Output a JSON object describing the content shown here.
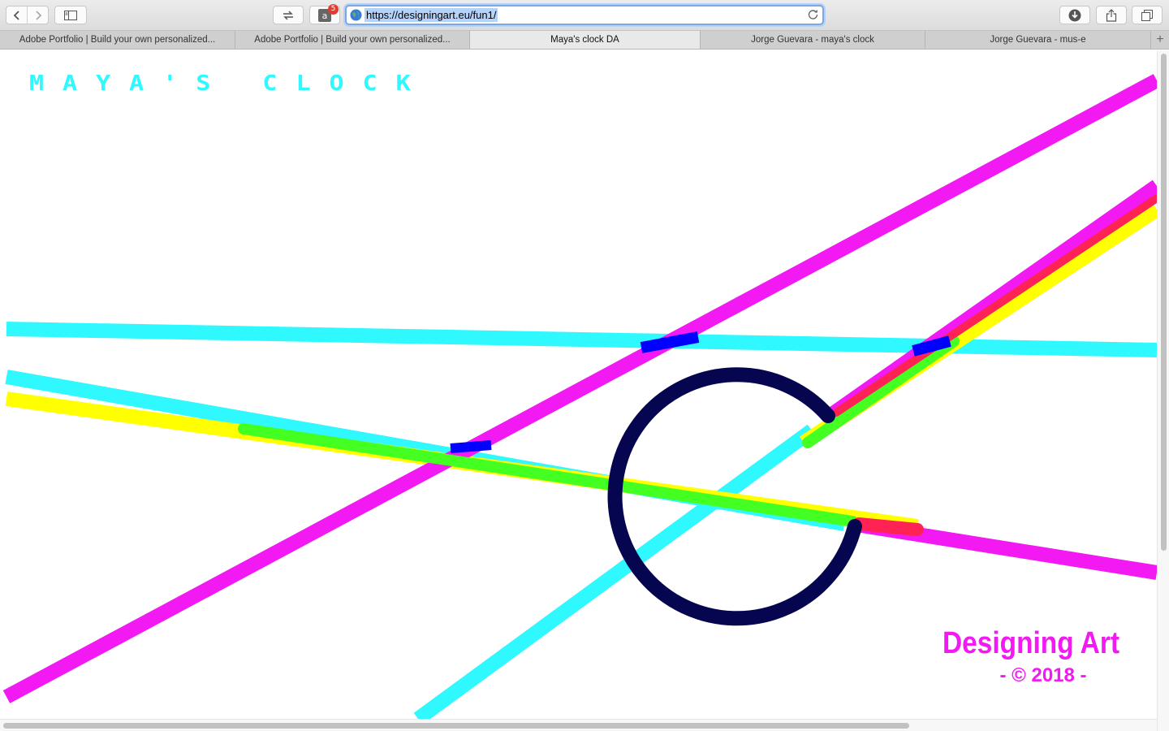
{
  "browser": {
    "url": "https://designingart.eu/fun1/",
    "amazon_badge": "5",
    "tabs": [
      {
        "label": "Adobe Portfolio | Build your own personalized..."
      },
      {
        "label": "Adobe Portfolio | Build your own personalized..."
      },
      {
        "label": "Maya's clock DA"
      },
      {
        "label": "Jorge Guevara - maya's clock"
      },
      {
        "label": "Jorge Guevara - mus-e"
      }
    ],
    "new_tab_label": "+"
  },
  "page": {
    "title": "MAYA'S  CLOCK",
    "brand_name": "Designing Art",
    "brand_year": "- © 2018 -"
  },
  "colors": {
    "cyan": "#2ff8ff",
    "magenta": "#f219f2",
    "yellow": "#ffff00",
    "green": "#44ff22",
    "red": "#ff2255",
    "blue": "#0000ff",
    "navy": "#050550"
  },
  "icons": [
    "back-icon",
    "forward-icon",
    "sidebar-icon",
    "reader-icon",
    "amazon-icon",
    "globe-icon",
    "reload-icon",
    "download-icon",
    "share-icon",
    "tabs-icon"
  ]
}
